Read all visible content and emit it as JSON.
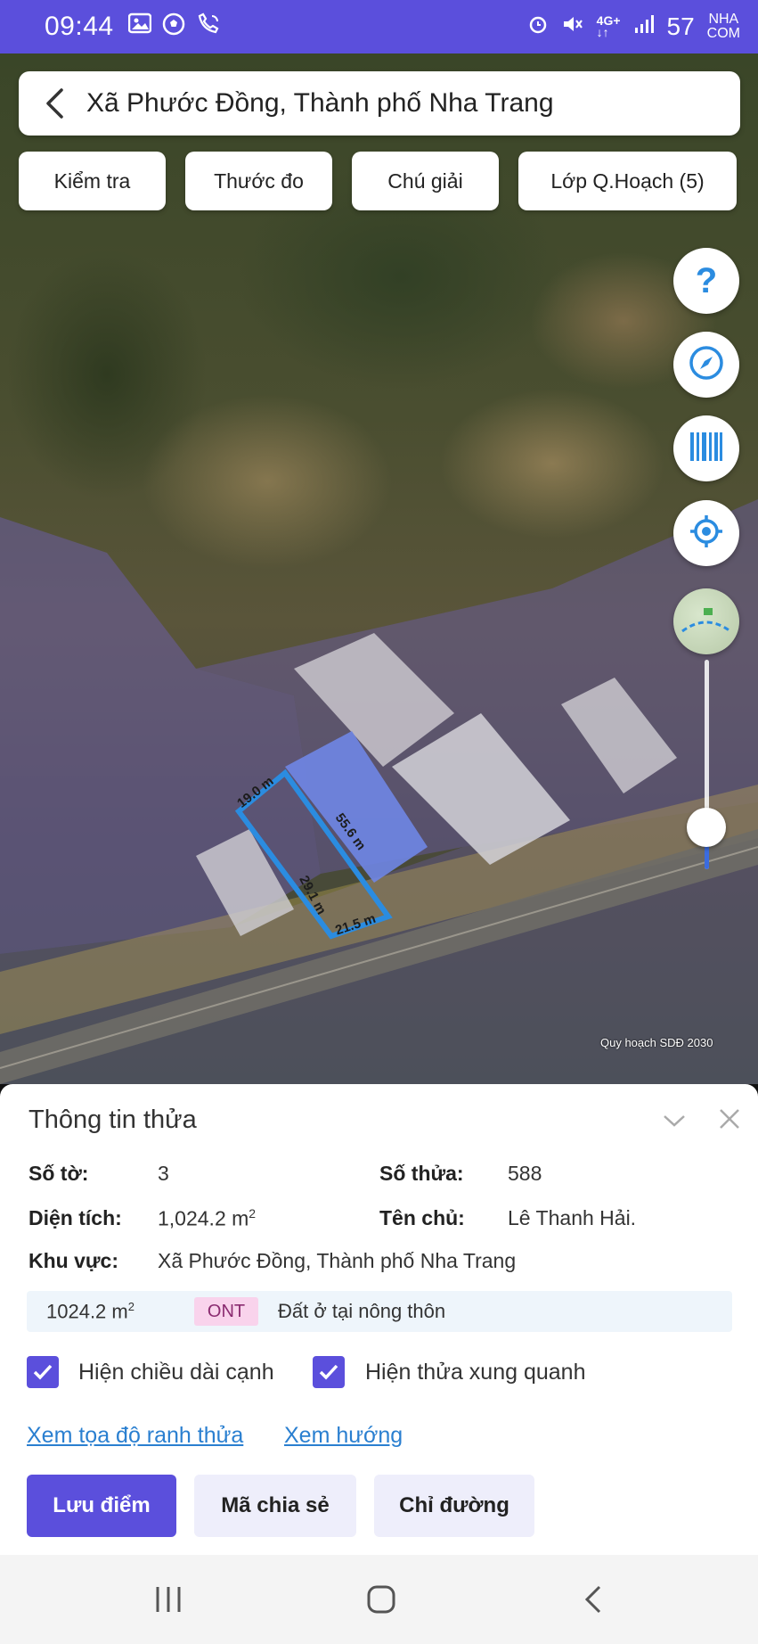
{
  "status_bar": {
    "time": "09:44",
    "battery": "57",
    "watermark_top": "NHA",
    "watermark_bottom": "COM",
    "icons": [
      "image-icon",
      "soccer-icon",
      "wifi-calling-icon",
      "alarm-icon",
      "mute-icon",
      "4g-icon",
      "signal-icon"
    ]
  },
  "search": {
    "title": "Xã Phước Đồng, Thành phố Nha Trang"
  },
  "chips": [
    "Kiểm tra",
    "Thước đo",
    "Chú giải",
    "Lớp Q.Hoạch (5)"
  ],
  "fabs": {
    "help": "?"
  },
  "map": {
    "edge_labels": [
      "19.0 m",
      "55.6 m",
      "29.1 m",
      "21.5 m"
    ],
    "credit": "Quy hoạch SDĐ 2030",
    "accent": "#2b8ce0",
    "overlay_color": "#7a6cc8"
  },
  "zoom_level": 0.2,
  "sheet": {
    "title": "Thông tin thửa",
    "so_to_label": "Số tờ:",
    "so_to_value": "3",
    "so_thua_label": "Số thửa:",
    "so_thua_value": "588",
    "dien_tich_label": "Diện tích:",
    "dien_tich_value": "1,024.2 m",
    "dien_tich_sup": "2",
    "ten_chu_label": "Tên chủ:",
    "ten_chu_value": "Lê Thanh Hải.",
    "khu_vuc_label": "Khu vực:",
    "khu_vuc_value": "Xã Phước Đồng, Thành phố Nha Trang",
    "land": {
      "area": "1024.2 m",
      "area_sup": "2",
      "code": "ONT",
      "description": "Đất ở tại nông thôn"
    },
    "check_edges": "Hiện chiều dài cạnh",
    "check_neighbors": "Hiện thửa xung quanh",
    "link_coords": "Xem tọa độ ranh thửa",
    "link_direction": "Xem hướng",
    "btn_save": "Lưu điểm",
    "btn_share": "Mã chia sẻ",
    "btn_route": "Chỉ đường"
  },
  "colors": {
    "primary": "#5b4fdc",
    "link": "#2a7fd0",
    "badge_bg": "#f9d3ec"
  }
}
